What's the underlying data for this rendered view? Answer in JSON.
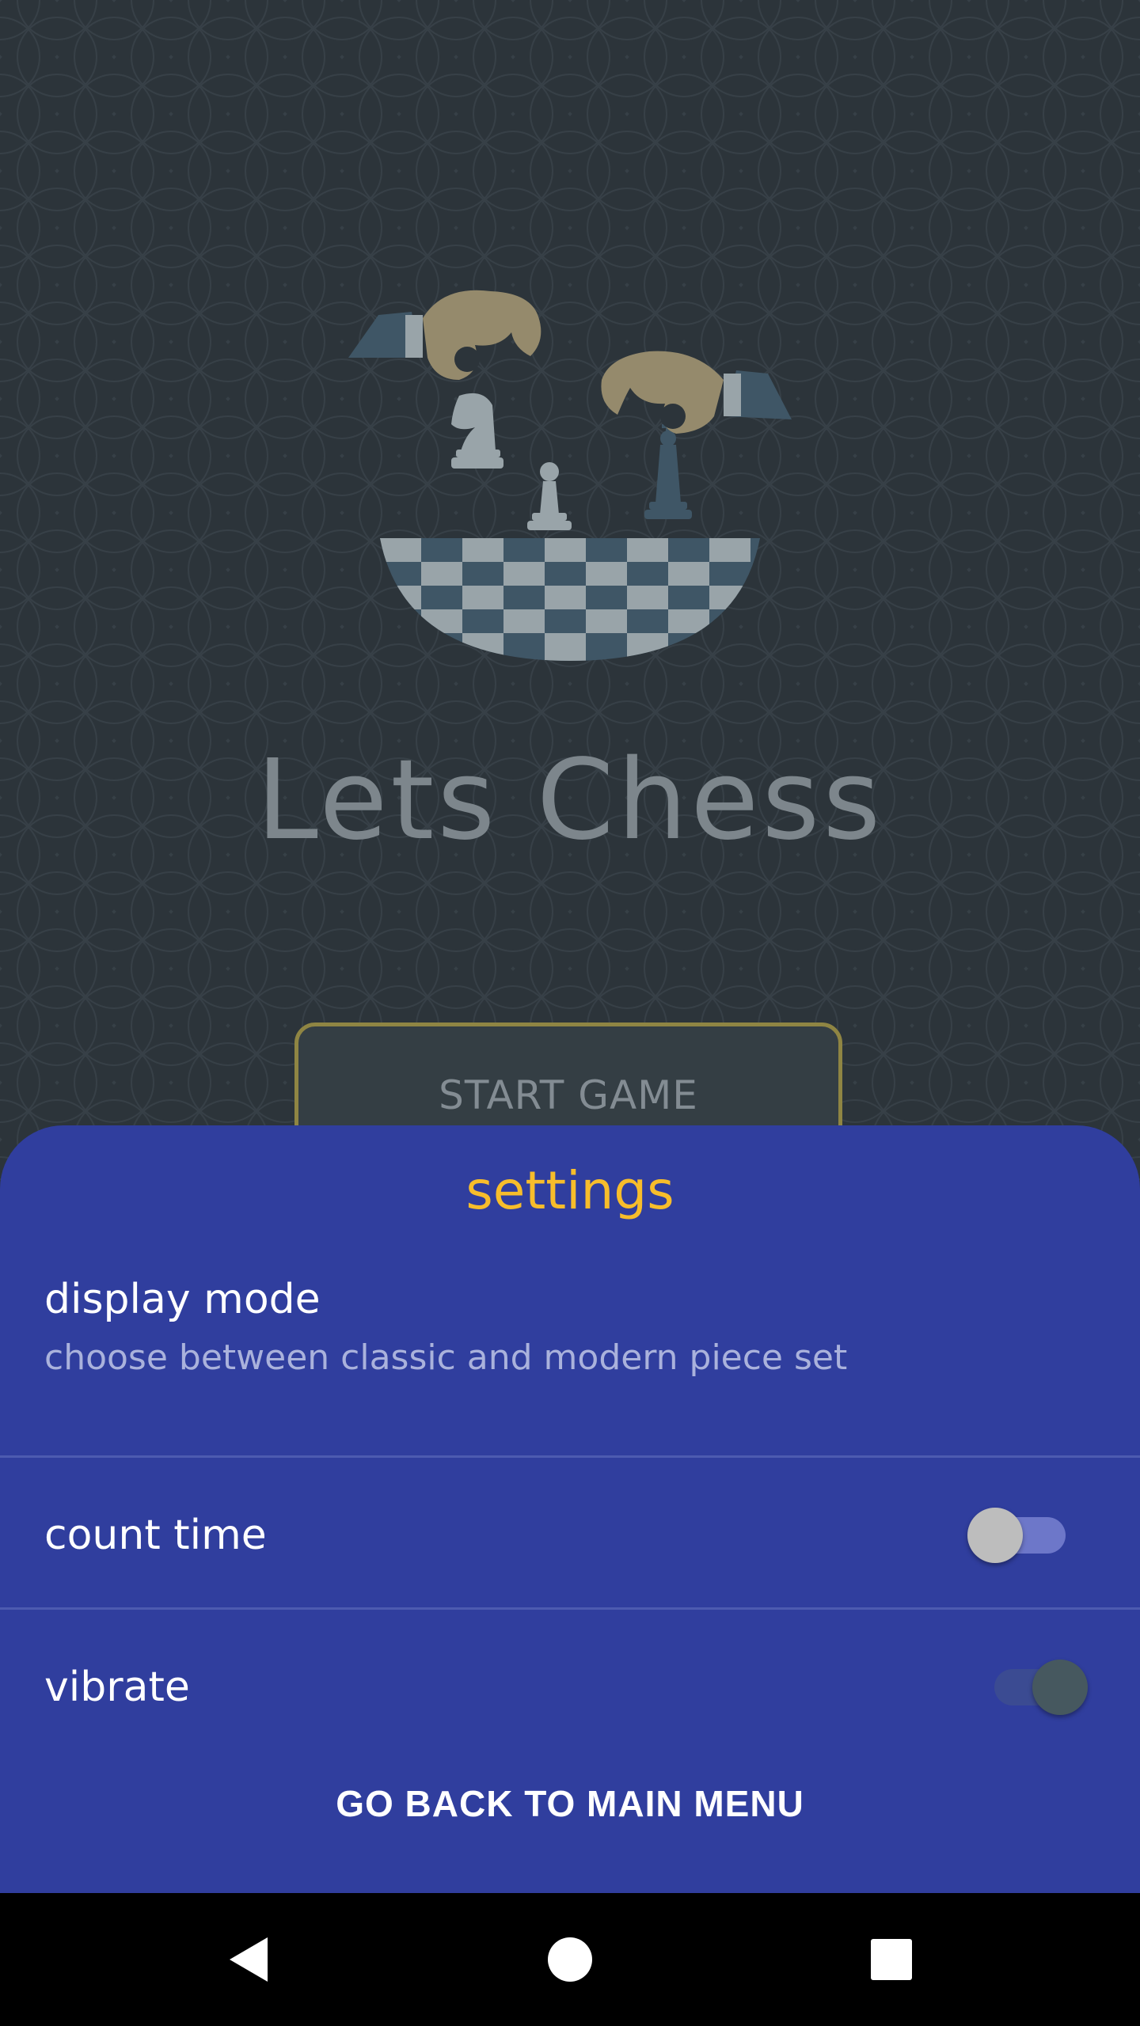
{
  "app": {
    "title": "Lets Chess",
    "start_button_label": "START GAME"
  },
  "settings_sheet": {
    "title": "settings",
    "items": [
      {
        "title": "display mode",
        "summary": "choose between classic and modern piece set"
      },
      {
        "title": "count time",
        "toggle": "off"
      },
      {
        "title": "vibrate",
        "toggle": "on"
      }
    ],
    "back_button_label": "GO BACK TO MAIN MENU"
  },
  "navbar": {
    "buttons": [
      "back-icon",
      "home-icon",
      "recents-icon"
    ]
  },
  "colors": {
    "background": "#2c343a",
    "sheet": "#303e9e",
    "sheet_title": "#f7bd2b",
    "start_button_border": "#8f8543"
  }
}
